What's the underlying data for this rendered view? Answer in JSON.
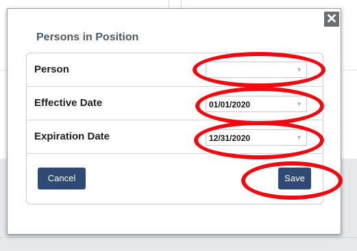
{
  "modal": {
    "title": "Persons in Position",
    "close_glyph": "✕"
  },
  "form": {
    "fields": [
      {
        "label": "Person",
        "value": ""
      },
      {
        "label": "Effective Date",
        "value": "01/01/2020"
      },
      {
        "label": "Expiration Date",
        "value": "12/31/2020"
      }
    ],
    "dropdown_glyph": "▼"
  },
  "actions": {
    "cancel_label": "Cancel",
    "save_label": "Save"
  },
  "colors": {
    "button_bg": "#2e4a74",
    "annotation": "#ee0a10",
    "title": "#4b5a6c"
  }
}
